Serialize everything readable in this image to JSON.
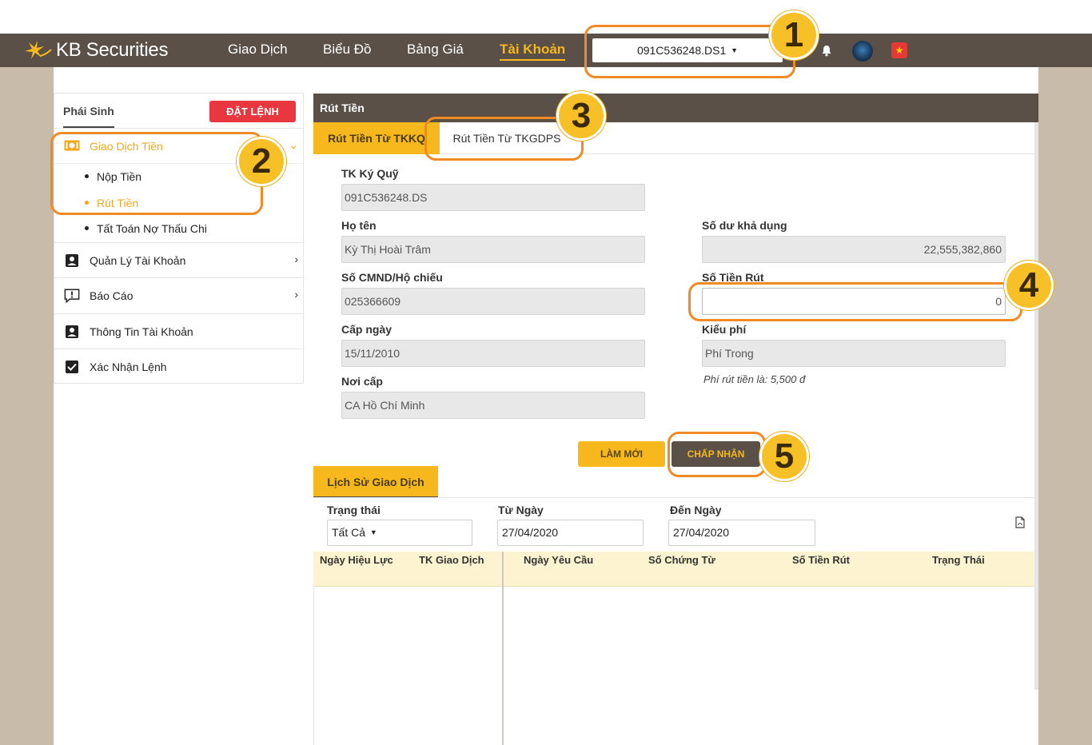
{
  "nav": {
    "brand": "KB Securities",
    "items": [
      "Giao Dịch",
      "Biểu Đồ",
      "Bảng Giá",
      "Tài Khoản"
    ],
    "active_index": 3,
    "account": "091C536248.DS1",
    "flag": "★"
  },
  "sidebar": {
    "title": "Phái Sinh",
    "order_button": "ĐẶT LỆNH",
    "groups": [
      {
        "label": "Giao Dịch Tiền",
        "icon": "money-icon",
        "expanded": true
      },
      {
        "label": "Quản Lý Tài Khoản",
        "icon": "person-badge-icon"
      },
      {
        "label": "Báo Cáo",
        "icon": "report-icon"
      },
      {
        "label": "Thông Tin Tài Khoản",
        "icon": "account-info-icon"
      },
      {
        "label": "Xác Nhận Lệnh",
        "icon": "checkbox-icon"
      }
    ],
    "sub_items": [
      "Nộp Tiền",
      "Rút Tiền",
      "Tất Toán Nợ Thấu Chi"
    ],
    "active_sub": "Rút Tiền"
  },
  "panel": {
    "title": "Rút Tiền",
    "tabs": [
      "Rút Tiền Từ TKKQ",
      "Rút Tiền Từ TKGDPS"
    ],
    "active_tab": 0
  },
  "form": {
    "margin_account_label": "TK Ký Quỹ",
    "margin_account": "091C536248.DS",
    "name_label": "Họ tên",
    "name": "Kỳ Thị Hoài Trâm",
    "id_label": "Số CMND/Hộ chiếu",
    "id_number": "025366609",
    "issue_date_label": "Cấp ngày",
    "issue_date": "15/11/2010",
    "issue_place_label": "Nơi cấp",
    "issue_place": "CA Hồ Chí Minh",
    "balance_label": "Số dư khả dụng",
    "balance": "22,555,382,860",
    "amount_label": "Số Tiền Rút",
    "amount": "0",
    "fee_type_label": "Kiểu phí",
    "fee_type": "Phí Trong",
    "fee_note": "Phí rút tiền là: 5,500 đ",
    "refresh_button": "LÀM MỚI",
    "accept_button": "CHẤP NHẬN"
  },
  "history": {
    "tab": "Lịch Sử Giao Dịch",
    "status_label": "Trạng thái",
    "status_value": "Tất Cả",
    "from_label": "Từ Ngày",
    "from_value": "27/04/2020",
    "to_label": "Đến Ngày",
    "to_value": "27/04/2020",
    "columns": [
      "Ngày Hiệu Lực",
      "TK Giao Dịch",
      "Ngày Yêu Cầu",
      "Số Chứng Từ",
      "Số Tiền Rút",
      "Trạng Thái"
    ]
  },
  "annotations": [
    "1",
    "2",
    "3",
    "4",
    "5"
  ],
  "colors": {
    "header_bg": "#5a5048",
    "accent": "#f6b81c",
    "danger": "#e8373e",
    "annotation_stroke": "#f08a24",
    "annotation_fill": "#f6c026"
  }
}
